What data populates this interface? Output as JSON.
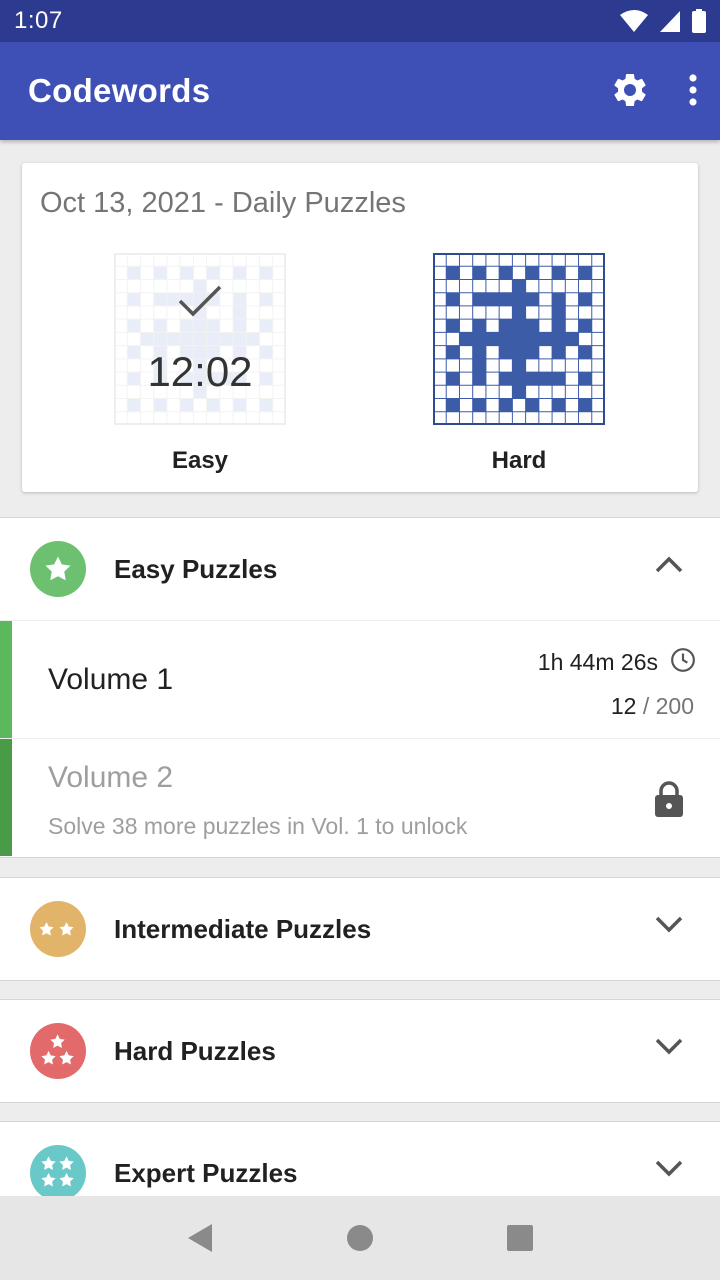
{
  "status_bar": {
    "time": "1:07"
  },
  "app_bar": {
    "title": "Codewords"
  },
  "daily": {
    "title": "Oct 13, 2021 - Daily Puzzles",
    "easy": {
      "label": "Easy",
      "time": "12:02",
      "solved": true
    },
    "hard": {
      "label": "Hard"
    }
  },
  "sections": {
    "easy": {
      "title": "Easy Puzzles",
      "badge_color": "#6cc070",
      "expanded": true,
      "volumes": [
        {
          "name": "Volume 1",
          "time": "1h 44m 26s",
          "solved": "12",
          "total": "/ 200",
          "strip_color": "#5cb85c"
        },
        {
          "name": "Volume 2",
          "hint": "Solve 38 more puzzles in Vol. 1 to unlock",
          "locked": true,
          "strip_color": "#4a9b48"
        }
      ]
    },
    "intermediate": {
      "title": "Intermediate Puzzles",
      "badge_color": "#e2b46a"
    },
    "hard": {
      "title": "Hard Puzzles",
      "badge_color": "#e26a6a"
    },
    "expert": {
      "title": "Expert Puzzles",
      "badge_color": "#69c9c9"
    }
  },
  "colors": {
    "primary": "#3e4fb5",
    "primary_dark": "#2c3a8f",
    "grid_blue": "#3d5ca8"
  }
}
